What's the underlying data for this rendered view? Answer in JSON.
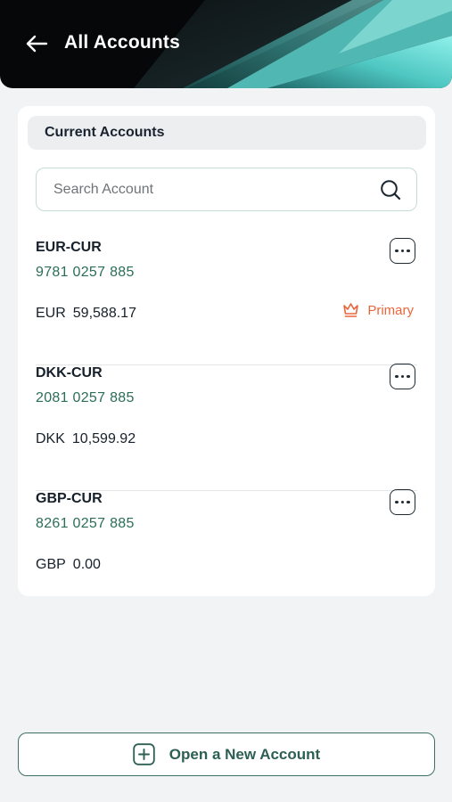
{
  "header": {
    "title": "All Accounts",
    "back_icon": "arrow-left-icon"
  },
  "section": {
    "title": "Current Accounts"
  },
  "search": {
    "placeholder": "Search Account",
    "value": "",
    "icon": "search-icon"
  },
  "accounts": [
    {
      "name": "EUR-CUR",
      "number": "9781 0257 885",
      "currency": "EUR",
      "balance": "59,588.17",
      "primary_label": "Primary",
      "primary_icon": "crown-icon"
    },
    {
      "name": "DKK-CUR",
      "number": "2081 0257 885",
      "currency": "DKK",
      "balance": "10,599.92"
    },
    {
      "name": "GBP-CUR",
      "number": "8261 0257 885",
      "currency": "GBP",
      "balance": "0.00"
    }
  ],
  "footer": {
    "open_account_label": "Open a New Account",
    "open_account_icon": "plus-square-icon"
  },
  "colors": {
    "header_bg": "#050708",
    "accent_teal": "#5fd6d0",
    "account_number": "#2b6e57",
    "primary_badge": "#e8663d",
    "button_border": "#3d6f63"
  }
}
